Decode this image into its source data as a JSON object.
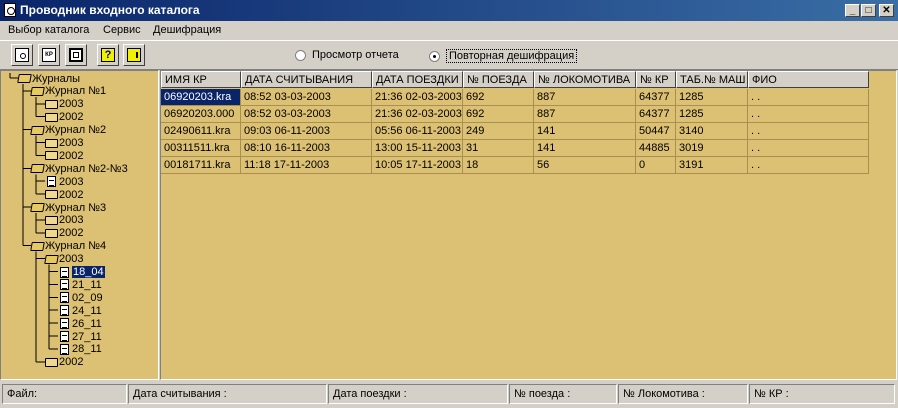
{
  "window": {
    "title": "Проводник входного каталога"
  },
  "title_buttons": {
    "minimize": "_",
    "maximize": "□",
    "close": "✕"
  },
  "menu": [
    "Выбор каталога",
    "Сервис",
    "Дешифрация"
  ],
  "toolbar": {
    "buttons": [
      "preview-icon",
      "kp-icon",
      "device-icon",
      "help-icon",
      "exit-icon"
    ],
    "kp_button_text": "КР",
    "help_text": "?",
    "radios": [
      {
        "label": "Просмотр отчета",
        "selected": false
      },
      {
        "label": "Повторная дешифрация",
        "selected": true
      }
    ]
  },
  "tree": [
    {
      "label": "Журналы",
      "icon": "folder-open-icon"
    },
    {
      "label": "Журнал №1",
      "icon": "folder-open-icon"
    },
    {
      "label": "2003",
      "icon": "folder-icon"
    },
    {
      "label": "2002",
      "icon": "folder-icon"
    },
    {
      "label": "Журнал №2",
      "icon": "folder-open-icon"
    },
    {
      "label": "2003",
      "icon": "folder-icon"
    },
    {
      "label": "2002",
      "icon": "folder-icon"
    },
    {
      "label": "Журнал №2-№3",
      "icon": "folder-open-icon"
    },
    {
      "label": "2003",
      "icon": "document-icon"
    },
    {
      "label": "2002",
      "icon": "folder-icon"
    },
    {
      "label": "Журнал №3",
      "icon": "folder-open-icon"
    },
    {
      "label": "2003",
      "icon": "folder-icon"
    },
    {
      "label": "2002",
      "icon": "folder-icon"
    },
    {
      "label": "Журнал №4",
      "icon": "folder-open-icon"
    },
    {
      "label": "2003",
      "icon": "folder-open-icon"
    },
    {
      "label": "18_04",
      "icon": "document-icon",
      "selected": true
    },
    {
      "label": "21_11",
      "icon": "document-icon"
    },
    {
      "label": "02_09",
      "icon": "document-icon"
    },
    {
      "label": "24_11",
      "icon": "document-icon"
    },
    {
      "label": "26_11",
      "icon": "document-icon"
    },
    {
      "label": "27_11",
      "icon": "document-icon"
    },
    {
      "label": "28_11",
      "icon": "document-icon"
    },
    {
      "label": "2002",
      "icon": "folder-icon"
    }
  ],
  "grid": {
    "columns": [
      "ИМЯ КР",
      "ДАТА СЧИТЫВАНИЯ",
      "ДАТА ПОЕЗДКИ",
      "№ ПОЕЗДА",
      "№ ЛОКОМОТИВА",
      "№ КР",
      "ТАБ.№ МАШ",
      "ФИО"
    ],
    "rows": [
      [
        "06920203.kra",
        "08:52 03-03-2003",
        "21:36 02-03-2003",
        "692",
        "887",
        "64377",
        "1285",
        ". ."
      ],
      [
        "06920203.000",
        "08:52 03-03-2003",
        "21:36 02-03-2003",
        "692",
        "887",
        "64377",
        "1285",
        ". ."
      ],
      [
        "02490611.kra",
        "09:03 06-11-2003",
        "05:56 06-11-2003",
        "249",
        "141",
        "50447",
        "3140",
        ". ."
      ],
      [
        "00311511.kra",
        "08:10 16-11-2003",
        "13:00 15-11-2003",
        "31",
        "141",
        "44885",
        "3019",
        ". ."
      ],
      [
        "00181711.kra",
        "11:18 17-11-2003",
        "10:05 17-11-2003",
        "18",
        "56",
        "0",
        "3191",
        ". ."
      ]
    ],
    "selected_row": 0
  },
  "status": [
    "Файл:",
    "Дата считывания :",
    "Дата поездки :",
    "№ поезда :",
    "№ Локомотива :",
    "№ КР :"
  ]
}
